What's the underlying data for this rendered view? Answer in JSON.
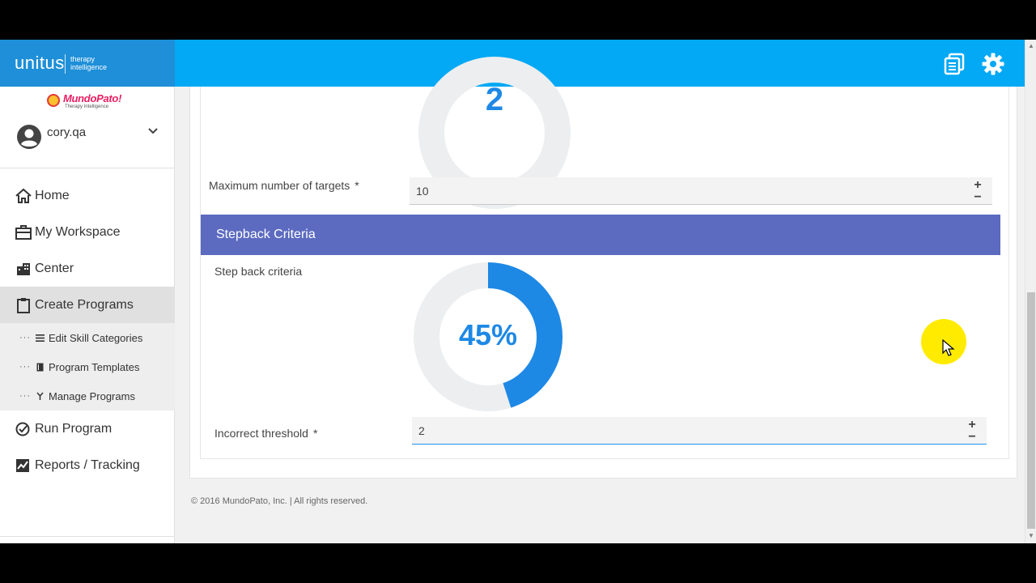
{
  "brand": {
    "logo_text": "unitus",
    "tagline": "therapy intelligence"
  },
  "partner": {
    "name": "MundoPato!",
    "tagline": "Therapy Intelligence"
  },
  "user": {
    "name": "cory.qa"
  },
  "nav": {
    "home": "Home",
    "workspace": "My Workspace",
    "center": "Center",
    "create_programs": "Create Programs",
    "sub": {
      "edit_skill_categories": "Edit Skill Categories",
      "program_templates": "Program Templates",
      "manage_programs": "Manage Programs"
    },
    "run_program": "Run Program",
    "reports": "Reports / Tracking"
  },
  "form": {
    "top_gauge_value": "2",
    "max_targets_label": "Maximum number of targets",
    "max_targets_value": "10",
    "stepback_header": "Stepback Criteria",
    "stepback_label": "Step back criteria",
    "stepback_value": "45%",
    "stepback_fraction": 0.45,
    "incorrect_label": "Incorrect threshold",
    "incorrect_value": "2",
    "required_mark": "*",
    "plus": "+",
    "minus": "−"
  },
  "footer": {
    "copyright": "© 2016 MundoPato, Inc. | All rights reserved."
  },
  "colors": {
    "topbar": "#03a9f4",
    "brand": "#1e8fd8",
    "section_header": "#5c6bc0",
    "gauge_fill": "#1e88e5",
    "gauge_track": "#eceef0"
  }
}
